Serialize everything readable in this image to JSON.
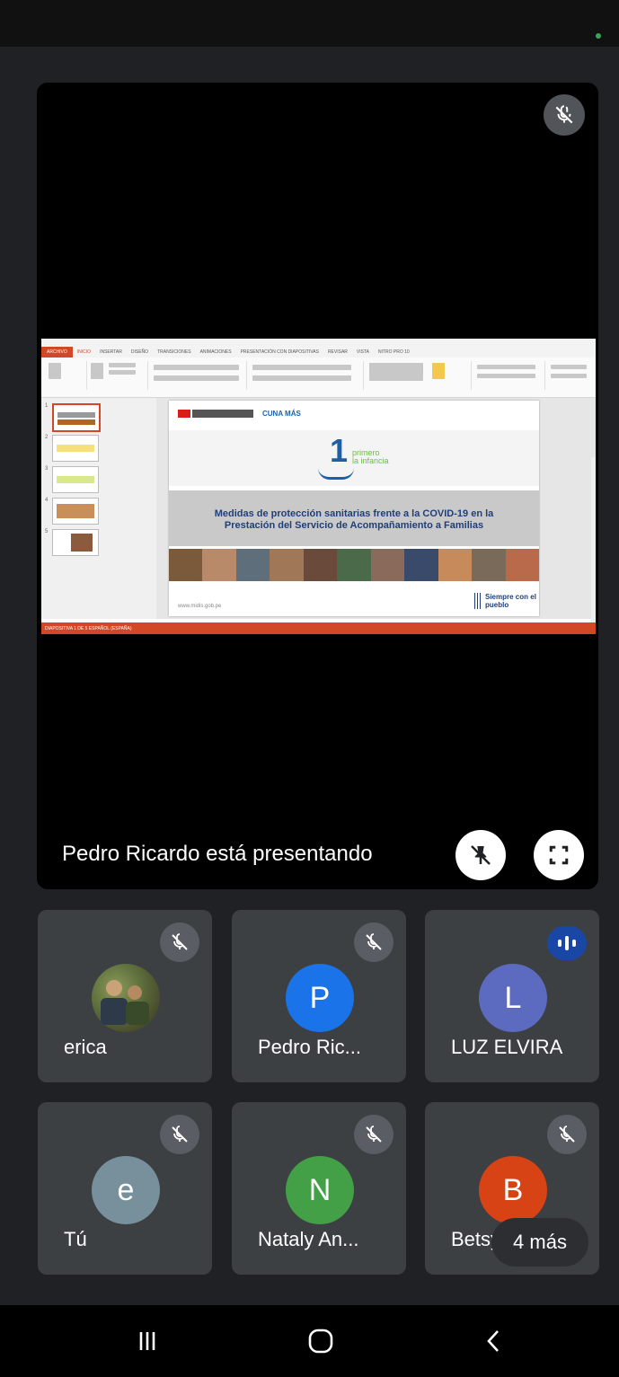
{
  "status_bar": {
    "camera_indicator_color": "#34a853"
  },
  "presentation": {
    "presenter_text": "Pedro Ricardo está presentando",
    "mute_icon": "mic-off-icon",
    "pin_icon": "unpin-icon",
    "fullscreen_icon": "fullscreen-icon",
    "shared_content": {
      "app": "PowerPoint",
      "ribbon_tabs": [
        "ARCHIVO",
        "INICIO",
        "INSERTAR",
        "DISEÑO",
        "TRANSICIONES",
        "ANIMACIONES",
        "PRESENTACIÓN CON DIAPOSITIVAS",
        "REVISAR",
        "VISTA",
        "NITRO PRO 10"
      ],
      "slide_thumbnail_numbers": [
        "1",
        "2",
        "3",
        "4",
        "5"
      ],
      "slide": {
        "logo_number": "1",
        "logo_line1": "primero",
        "logo_line2": "la infancia",
        "cuna_logo": "CUNA MÁS",
        "title_line1": "Medidas de protección sanitarias frente a la COVID-19 en la",
        "title_line2": "Prestación del Servicio de Acompañamiento a Familias",
        "url": "www.midis.gob.pe",
        "footer_logo": "Siempre con el pueblo"
      },
      "status_left": "DIAPOSITIVA 1 DE 5   ESPAÑOL (ESPAÑA)",
      "accent_color": "#d24726"
    }
  },
  "participants": [
    {
      "name": "erica",
      "initial": "",
      "avatar_color": "#5b6b3a",
      "mic": "muted",
      "has_photo": true
    },
    {
      "name": "Pedro Ric...",
      "initial": "P",
      "avatar_color": "#1a73e8",
      "mic": "muted"
    },
    {
      "name": "LUZ ELVIRA",
      "initial": "L",
      "avatar_color": "#5c6bc0",
      "mic": "speaking"
    },
    {
      "name": "Tú",
      "initial": "e",
      "avatar_color": "#78909c",
      "mic": "muted"
    },
    {
      "name": "Nataly An...",
      "initial": "N",
      "avatar_color": "#43a047",
      "mic": "muted"
    },
    {
      "name": "Betsy",
      "initial": "B",
      "avatar_color": "#d84315",
      "mic": "muted"
    }
  ],
  "more_participants": "4 más",
  "nav": {
    "recents_icon": "recents-icon",
    "home_icon": "home-icon",
    "back_icon": "back-icon"
  }
}
